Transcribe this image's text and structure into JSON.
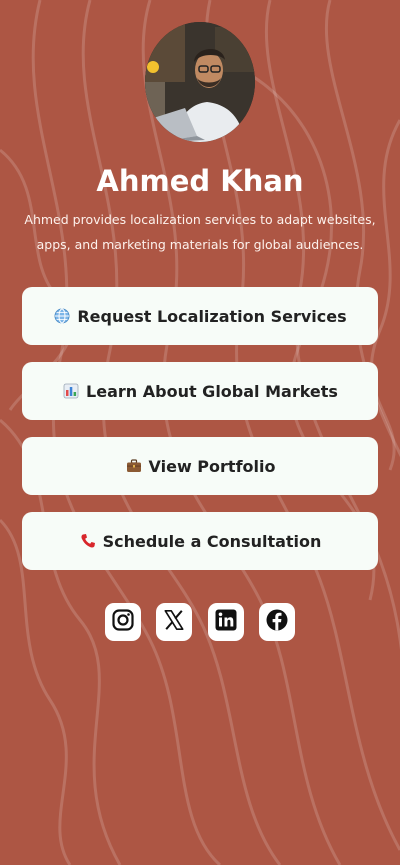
{
  "profile": {
    "name": "Ahmed Khan",
    "bio": "Ahmed provides localization services to adapt websites, apps, and marketing materials for global audiences."
  },
  "links": [
    {
      "label": "Request Localization Services",
      "icon": "globe-icon"
    },
    {
      "label": "Learn About Global Markets",
      "icon": "bar-chart-icon"
    },
    {
      "label": "View Portfolio",
      "icon": "briefcase-icon"
    },
    {
      "label": "Schedule a Consultation",
      "icon": "telephone-icon"
    }
  ],
  "social": [
    {
      "network": "Instagram",
      "icon": "instagram-icon"
    },
    {
      "network": "X",
      "icon": "x-icon"
    },
    {
      "network": "LinkedIn",
      "icon": "linkedin-icon"
    },
    {
      "network": "Facebook",
      "icon": "facebook-icon"
    }
  ],
  "colors": {
    "background": "#ad5644",
    "button": "#f7fcf8",
    "button_text": "#222222"
  }
}
